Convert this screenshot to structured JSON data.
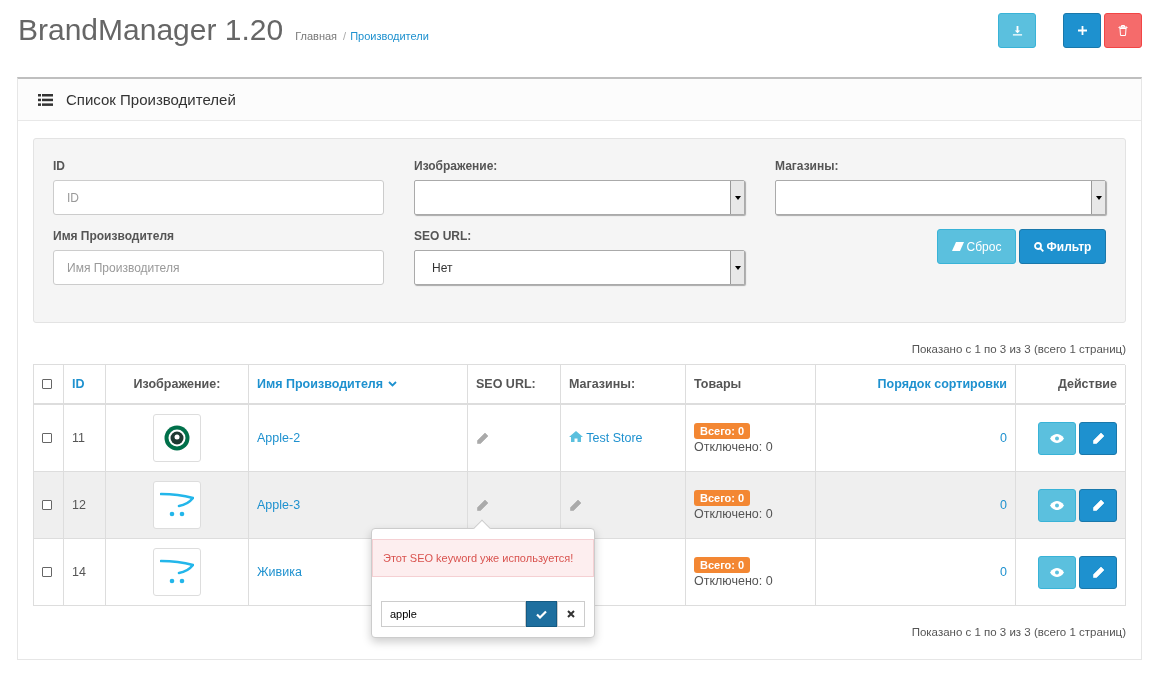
{
  "header": {
    "title": "BrandManager 1.20",
    "breadcrumb_separator": "/",
    "breadcrumbs": [
      {
        "label": "Главная",
        "current": false
      },
      {
        "label": "Производители",
        "current": true
      }
    ]
  },
  "panel": {
    "title": "Список Производителей",
    "filter": {
      "fields": [
        {
          "kind": "text",
          "label": "ID",
          "placeholder": "ID"
        },
        {
          "kind": "select",
          "label": "Изображение:"
        },
        {
          "kind": "select",
          "label": "Магазины:"
        },
        {
          "kind": "text",
          "label": "Имя Производителя",
          "placeholder": "Имя Производителя"
        },
        {
          "kind": "select",
          "label": "SEO URL:",
          "value": "Нет"
        }
      ],
      "reset_label": "Сброс",
      "filter_label": "Фильтр"
    },
    "summary_top": "Показано с 1 по 3 из 3 (всего 1 страниц)",
    "table": {
      "columns": [
        {
          "kind": "check",
          "checked": false
        },
        {
          "kind": "sort",
          "label": "ID"
        },
        {
          "kind": "plain-center",
          "label": "Изображение:"
        },
        {
          "kind": "sorted",
          "label": "Имя Производителя"
        },
        {
          "kind": "plain",
          "label": "SEO URL:"
        },
        {
          "kind": "plain",
          "label": "Магазины:"
        },
        {
          "kind": "plain",
          "label": "Товары"
        },
        {
          "kind": "sort-right",
          "label": "Порядок сортировки"
        },
        {
          "kind": "plain-right",
          "label": "Действие"
        }
      ],
      "rows": [
        {
          "checked": false,
          "highlighted": false,
          "id": "11",
          "image": {
            "kind": "round-logo"
          },
          "name": "Apple-2",
          "store": {
            "kind": "link",
            "label": "Test Store"
          },
          "total": "Всего: 0",
          "disabled": "Отключено: 0",
          "sort_order": "0"
        },
        {
          "checked": false,
          "highlighted": true,
          "id": "12",
          "image": {
            "kind": "cart-logo"
          },
          "name": "Apple-3",
          "store": {
            "kind": "edit"
          },
          "total": "Всего: 0",
          "disabled": "Отключено: 0",
          "sort_order": "0"
        },
        {
          "checked": false,
          "highlighted": false,
          "id": "14",
          "image": {
            "kind": "cart-logo"
          },
          "name": "Живика",
          "store": {
            "kind": "none"
          },
          "total": "Всего: 0",
          "disabled": "Отключено: 0",
          "sort_order": "0"
        }
      ]
    },
    "popover": {
      "error": "Этот SEO keyword уже используется!",
      "value": "apple"
    },
    "summary_bottom": "Показано с 1 по 3 из 3 (всего 1 страниц)"
  }
}
